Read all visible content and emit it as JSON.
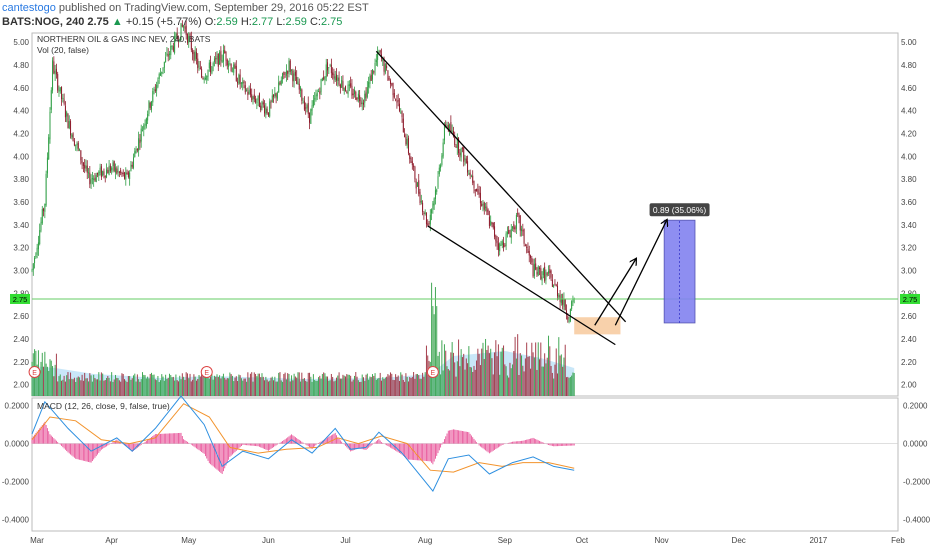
{
  "header": {
    "user": "cantestogo",
    "published": "published on TradingView.com, September 29, 2016 05:22 EST",
    "symbol": "BATS:NOG, 240",
    "last": "2.75",
    "change": "+0.15 (+5.77%)",
    "o_label": "O:",
    "o": "2.59",
    "h_label": "H:",
    "h": "2.77",
    "l_label": "L:",
    "l": "2.59",
    "c_label": "C:",
    "c": "2.75"
  },
  "colors": {
    "up": "#2e9e44",
    "down": "#8e1b2b",
    "vol_up": "#2e9e44",
    "vol_down": "#9c2b3b",
    "vol_ma": "#9dd3f2",
    "price_line": "#66cc66",
    "macd_line": "#2d8fe0",
    "signal_line": "#f2932c",
    "histogram": "#e8559a",
    "target_box": "#8282f0",
    "support_box": "#f7c99c"
  },
  "chart_data": [
    {
      "type": "candlestick",
      "title": "NORTHERN OIL & GAS INC NEV, 240, BATS",
      "volume_label": "Vol (20, false)",
      "ylim": [
        1.9,
        5.08
      ],
      "y_ticks": [
        "5.00",
        "4.80",
        "4.60",
        "4.40",
        "4.20",
        "4.00",
        "3.80",
        "3.60",
        "3.40",
        "3.20",
        "3.00",
        "2.80",
        "2.60",
        "2.40",
        "2.20",
        "2.00"
      ],
      "x_ticks": [
        "Mar",
        "Apr",
        "May",
        "Jun",
        "Jul",
        "Aug",
        "Sep",
        "Oct",
        "Nov",
        "Dec",
        "2017",
        "Feb"
      ],
      "x_range": [
        "2016-03-01",
        "2017-02-01"
      ],
      "price_path": [
        [
          "2016-03-01",
          3.0
        ],
        [
          "2016-03-06",
          3.6
        ],
        [
          "2016-03-09",
          4.8
        ],
        [
          "2016-03-15",
          4.3
        ],
        [
          "2016-03-23",
          3.8
        ],
        [
          "2016-04-01",
          3.9
        ],
        [
          "2016-04-07",
          3.8
        ],
        [
          "2016-04-15",
          4.4
        ],
        [
          "2016-04-21",
          4.8
        ],
        [
          "2016-04-29",
          5.15
        ],
        [
          "2016-05-06",
          4.7
        ],
        [
          "2016-05-15",
          4.9
        ],
        [
          "2016-05-22",
          4.6
        ],
        [
          "2016-06-01",
          4.4
        ],
        [
          "2016-06-09",
          4.8
        ],
        [
          "2016-06-17",
          4.35
        ],
        [
          "2016-06-24",
          4.8
        ],
        [
          "2016-07-01",
          4.6
        ],
        [
          "2016-07-08",
          4.5
        ],
        [
          "2016-07-14",
          4.9
        ],
        [
          "2016-07-21",
          4.5
        ],
        [
          "2016-07-27",
          3.9
        ],
        [
          "2016-08-02",
          3.4
        ],
        [
          "2016-08-06",
          3.8
        ],
        [
          "2016-08-09",
          4.3
        ],
        [
          "2016-08-16",
          4.0
        ],
        [
          "2016-08-23",
          3.6
        ],
        [
          "2016-08-30",
          3.2
        ],
        [
          "2016-09-06",
          3.45
        ],
        [
          "2016-09-12",
          3.0
        ],
        [
          "2016-09-18",
          2.95
        ],
        [
          "2016-09-22",
          2.8
        ],
        [
          "2016-09-26",
          2.6
        ],
        [
          "2016-09-28",
          2.75
        ]
      ],
      "last_price": "2.75",
      "volume_ma_peak": "early Mar and late Aug-Sep",
      "earnings_markers": [
        {
          "date": "2016-03-02",
          "label": "E"
        },
        {
          "date": "2016-05-08",
          "label": "E"
        },
        {
          "date": "2016-08-04",
          "label": "E"
        }
      ],
      "annotations": {
        "wedge_upper": [
          [
            "2016-07-13",
            4.92
          ],
          [
            "2016-10-18",
            2.55
          ]
        ],
        "wedge_lower": [
          [
            "2016-08-02",
            3.39
          ],
          [
            "2016-10-14",
            2.35
          ]
        ],
        "arrow_1": [
          [
            "2016-10-06",
            2.52
          ],
          [
            "2016-10-22",
            3.1
          ]
        ],
        "arrow_2": [
          [
            "2016-10-14",
            2.52
          ],
          [
            "2016-11-03",
            3.44
          ]
        ],
        "support_box": {
          "x": [
            "2016-09-28",
            "2016-10-16"
          ],
          "y": [
            2.44,
            2.59
          ]
        },
        "target_box": {
          "x": [
            "2016-11-02",
            "2016-11-14"
          ],
          "y": [
            2.54,
            3.44
          ]
        },
        "target_label": "0.89 (35.06%)"
      }
    },
    {
      "type": "line",
      "title": "MACD (12, 26, close, 9, false, true)",
      "ylim": [
        -0.46,
        0.24
      ],
      "y_ticks": [
        "0.2000",
        "0.0000",
        "-0.2000",
        "-0.4000"
      ],
      "series": [
        {
          "name": "MACD",
          "values": [
            [
              "2016-03-01",
              0.05
            ],
            [
              "2016-03-06",
              0.22
            ],
            [
              "2016-03-15",
              0.08
            ],
            [
              "2016-03-24",
              -0.04
            ],
            [
              "2016-04-03",
              0.03
            ],
            [
              "2016-04-09",
              -0.04
            ],
            [
              "2016-04-18",
              0.08
            ],
            [
              "2016-04-28",
              0.25
            ],
            [
              "2016-05-07",
              0.1
            ],
            [
              "2016-05-14",
              -0.12
            ],
            [
              "2016-05-22",
              -0.04
            ],
            [
              "2016-06-01",
              -0.08
            ],
            [
              "2016-06-10",
              0.02
            ],
            [
              "2016-06-18",
              -0.05
            ],
            [
              "2016-06-27",
              0.08
            ],
            [
              "2016-07-03",
              -0.03
            ],
            [
              "2016-07-09",
              -0.02
            ],
            [
              "2016-07-14",
              0.06
            ],
            [
              "2016-07-23",
              -0.05
            ],
            [
              "2016-08-01",
              -0.2
            ],
            [
              "2016-08-04",
              -0.25
            ],
            [
              "2016-08-10",
              -0.08
            ],
            [
              "2016-08-18",
              -0.06
            ],
            [
              "2016-08-26",
              -0.16
            ],
            [
              "2016-09-04",
              -0.1
            ],
            [
              "2016-09-12",
              -0.07
            ],
            [
              "2016-09-20",
              -0.12
            ],
            [
              "2016-09-28",
              -0.14
            ]
          ]
        },
        {
          "name": "Signal",
          "values": [
            [
              "2016-03-01",
              0.02
            ],
            [
              "2016-03-08",
              0.14
            ],
            [
              "2016-03-18",
              0.12
            ],
            [
              "2016-03-28",
              0.02
            ],
            [
              "2016-04-08",
              -0.0
            ],
            [
              "2016-04-18",
              0.03
            ],
            [
              "2016-04-29",
              0.21
            ],
            [
              "2016-05-09",
              0.14
            ],
            [
              "2016-05-17",
              -0.02
            ],
            [
              "2016-05-28",
              -0.05
            ],
            [
              "2016-06-08",
              -0.03
            ],
            [
              "2016-06-20",
              -0.02
            ],
            [
              "2016-06-28",
              0.03
            ],
            [
              "2016-07-06",
              0.0
            ],
            [
              "2016-07-15",
              0.04
            ],
            [
              "2016-07-25",
              0.0
            ],
            [
              "2016-08-03",
              -0.14
            ],
            [
              "2016-08-12",
              -0.15
            ],
            [
              "2016-08-22",
              -0.1
            ],
            [
              "2016-08-31",
              -0.12
            ],
            [
              "2016-09-08",
              -0.1
            ],
            [
              "2016-09-18",
              -0.1
            ],
            [
              "2016-09-28",
              -0.13
            ]
          ]
        }
      ]
    }
  ]
}
